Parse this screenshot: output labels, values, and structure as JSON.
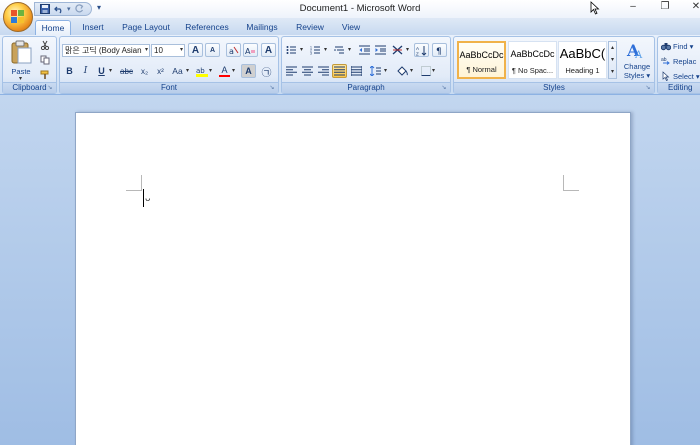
{
  "window": {
    "title": "Document1 - Microsoft Word",
    "controls": [
      "–",
      "❐",
      "✕"
    ]
  },
  "quick_access": {
    "more_glyph": "▾"
  },
  "tabs": [
    {
      "label": "Home",
      "active": true
    },
    {
      "label": "Insert",
      "active": false
    },
    {
      "label": "Page Layout",
      "active": false
    },
    {
      "label": "References",
      "active": false
    },
    {
      "label": "Mailings",
      "active": false
    },
    {
      "label": "Review",
      "active": false
    },
    {
      "label": "View",
      "active": false
    }
  ],
  "ribbon": {
    "clipboard": {
      "label": "Clipboard",
      "paste_label": "Paste"
    },
    "font": {
      "label": "Font",
      "font_name": "맑은 고딕 (Body Asian",
      "font_size": "10",
      "buttons": {
        "bold": "B",
        "italic": "I",
        "underline": "U",
        "strikethrough": "abc",
        "subscript": "x₂",
        "superscript": "x²",
        "change_case": "Aa",
        "font_color": "A",
        "char_shading": "A",
        "grow": "A",
        "shrink": "A",
        "clear": "A",
        "enclose": "㉠"
      }
    },
    "paragraph": {
      "label": "Paragraph"
    },
    "styles": {
      "label": "Styles",
      "items": [
        {
          "sample": "AaBbCcDc",
          "name": "¶ Normal",
          "selected": true
        },
        {
          "sample": "AaBbCcDc",
          "name": "¶ No Spac...",
          "selected": false
        },
        {
          "sample": "AaBbC(",
          "name": "Heading 1",
          "selected": false
        }
      ],
      "change_styles_line1": "Change",
      "change_styles_line2": "Styles ▾"
    },
    "editing": {
      "label": "Editing",
      "find": "Find ▾",
      "replace": "Replac",
      "select": "Select ▾"
    }
  },
  "colors": {
    "accent": "#15428b",
    "highlight": "#ffff00",
    "font_color": "#ff0000",
    "selected_style_border": "#f0b24a"
  }
}
